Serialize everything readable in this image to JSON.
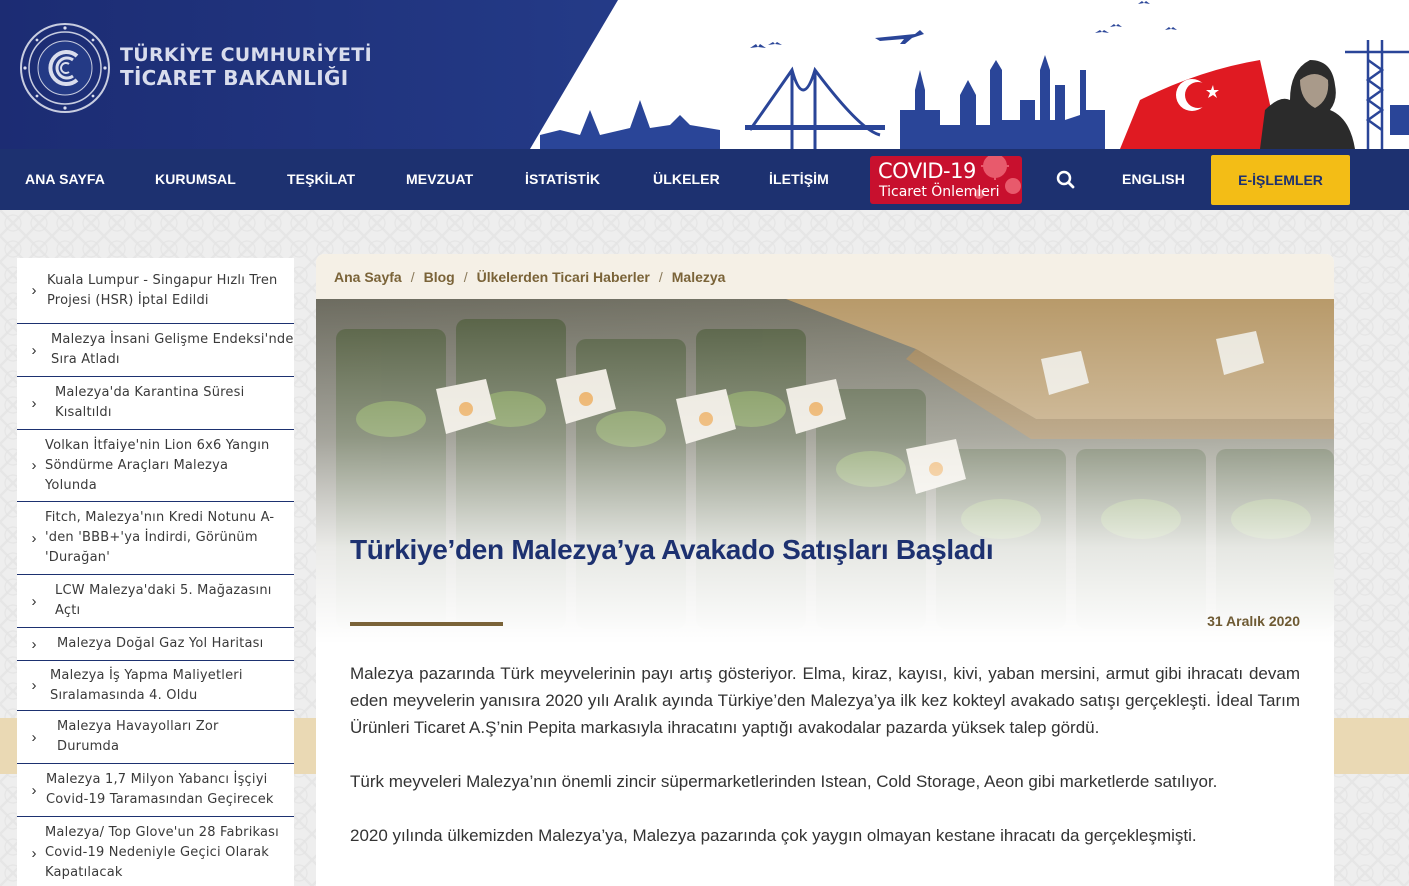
{
  "header": {
    "brand_line1": "TÜRKİYE CUMHURİYETİ",
    "brand_line2": "TİCARET BAKANLIĞI"
  },
  "nav": {
    "items": [
      "ANA SAYFA",
      "KURUMSAL",
      "TEŞKİLAT",
      "MEVZUAT",
      "İSTATİSTİK",
      "ÜLKELER",
      "İLETİŞİM"
    ],
    "covid_line1": "COVID-19",
    "covid_line2": "Ticaret Önlemleri",
    "english": "ENGLISH",
    "eislemler": "E-İŞLEMLER"
  },
  "sidebar": {
    "items": [
      "Kuala Lumpur - Singapur Hızlı Tren Projesi (HSR) İptal Edildi",
      "Malezya İnsani Gelişme Endeksi'nde Sıra Atladı",
      "Malezya'da Karantina Süresi Kısaltıldı",
      "Volkan İtfaiye'nin Lion 6x6 Yangın Söndürme Araçları Malezya Yolunda",
      "Fitch, Malezya'nın Kredi Notunu A- 'den 'BBB+'ya İndirdi, Görünüm 'Durağan'",
      "LCW Malezya'daki 5. Mağazasını Açtı",
      "Malezya Doğal Gaz Yol Haritası",
      "Malezya İş Yapma Maliyetleri Sıralamasında 4. Oldu",
      "Malezya Havayolları Zor Durumda",
      "Malezya 1,7 Milyon Yabancı İşçiyi Covid-19 Taramasından Geçirecek",
      "Malezya/ Top Glove'un 28 Fabrikası Covid-19 Nedeniyle Geçici Olarak Kapatılacak"
    ]
  },
  "breadcrumb": {
    "items": [
      "Ana Sayfa",
      "Blog",
      "Ülkelerden Ticari Haberler",
      "Malezya"
    ]
  },
  "article": {
    "title": "Türkiye’den Malezya’ya Avakado Satışları Başladı",
    "date": "31 Aralık 2020",
    "paragraphs": [
      "Malezya pazarında Türk meyvelerinin payı artış gösteriyor. Elma, kiraz, kayısı, kivi, yaban mersini, armut gibi ihracatı devam eden meyvelerin yanısıra 2020 yılı Aralık ayında Türkiye’den Malezya’ya ilk kez kokteyl avakado satışı gerçekleşti. İdeal Tarım Ürünleri Ticaret A.Ş’nin Pepita markasıyla ihracatını yaptığı avakodalar pazarda yüksek talep gördü.",
      "Türk meyveleri Malezya’nın önemli zincir süpermarketlerinden Istean, Cold Storage, Aeon gibi marketlerde satılıyor.",
      "2020 yılında ülkemizden Malezya’ya, Malezya pazarında çok yaygın olmayan kestane ihracatı da gerçekleşmişti."
    ]
  },
  "colors": {
    "navy": "#1d3170",
    "gold": "#f3bd16",
    "covid_red": "#c8102e",
    "brown": "#7a6338"
  }
}
